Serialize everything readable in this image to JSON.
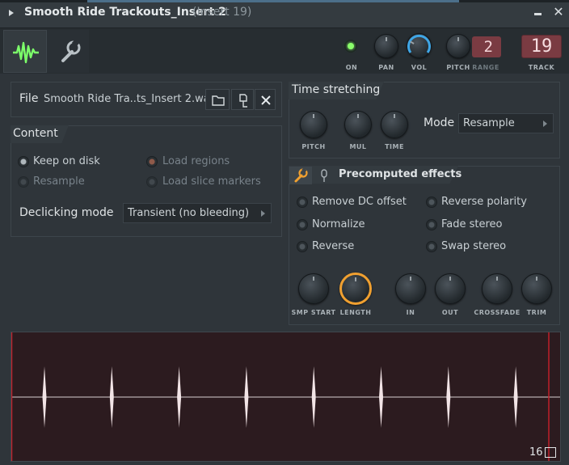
{
  "window": {
    "title": "Smooth Ride Trackouts_Insert 2",
    "subtitle": "(Insert 19)"
  },
  "toolbar": {
    "on_label": "ON",
    "pan_label": "PAN",
    "vol_label": "VOL",
    "pitch_label": "PITCH",
    "range_label": "RANGE",
    "range_value": "2",
    "track_label": "TRACK",
    "track_value": "19",
    "colors": {
      "on_led": "#8aff6b",
      "vol_accent": "#3fa6e6",
      "track_box": "#7a3b42",
      "sample_icon": "#7cff6a"
    },
    "icons": [
      "waveform-icon",
      "wrench-icon"
    ]
  },
  "file": {
    "label": "File",
    "name": "Smooth Ride Tra..ts_Insert 2.wav",
    "icons": [
      "folder-icon",
      "browse-icon",
      "close-icon"
    ]
  },
  "content": {
    "title": "Content",
    "options": [
      {
        "label": "Keep on disk",
        "checked": true,
        "enabled": true
      },
      {
        "label": "Resample",
        "checked": false,
        "enabled": false
      },
      {
        "label": "Load regions",
        "checked": true,
        "enabled": false
      },
      {
        "label": "Load slice markers",
        "checked": false,
        "enabled": false
      }
    ],
    "declicking_label": "Declicking mode",
    "declicking_value": "Transient (no bleeding)"
  },
  "time_stretching": {
    "title": "Time stretching",
    "knobs": [
      "PITCH",
      "MUL",
      "TIME"
    ],
    "mode_label": "Mode",
    "mode_value": "Resample"
  },
  "precomputed": {
    "title": "Precomputed effects",
    "options": [
      {
        "label": "Remove DC offset",
        "checked": false
      },
      {
        "label": "Reverse polarity",
        "checked": false
      },
      {
        "label": "Normalize",
        "checked": false
      },
      {
        "label": "Fade stereo",
        "checked": false
      },
      {
        "label": "Reverse",
        "checked": false
      },
      {
        "label": "Swap stereo",
        "checked": false
      }
    ],
    "knobs": [
      "SMP START",
      "LENGTH",
      "IN",
      "OUT",
      "CROSSFADE",
      "TRIM"
    ],
    "length_color": "#f0a030"
  },
  "waveform": {
    "count": "16",
    "spikes": 8,
    "spike_color": "#f2e4e6",
    "marker_color": "#c0202a"
  }
}
